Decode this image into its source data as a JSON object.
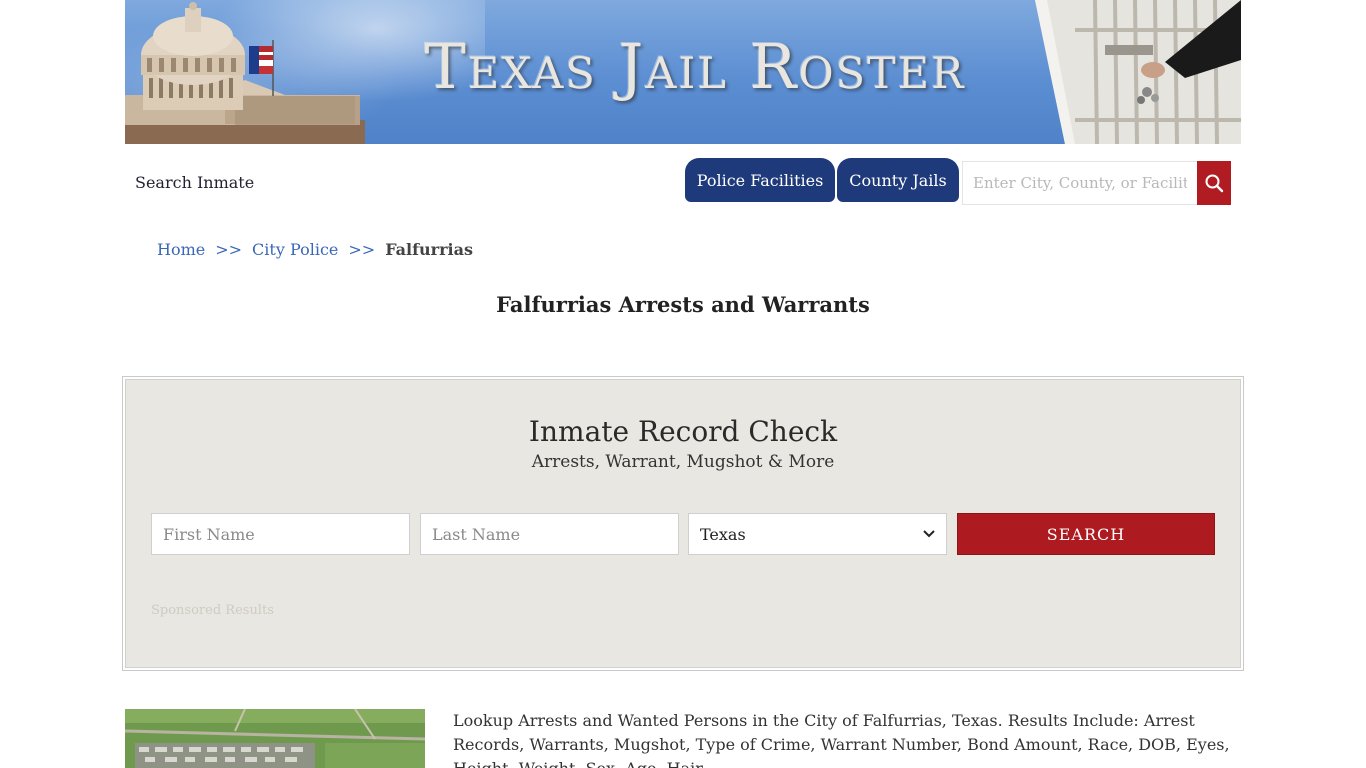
{
  "banner": {
    "title": "Texas Jail Roster"
  },
  "nav": {
    "search_inmate": "Search Inmate",
    "tabs": [
      {
        "label": "Police Facilities"
      },
      {
        "label": "County Jails"
      }
    ],
    "site_search_placeholder": "Enter City, County, or Facility"
  },
  "breadcrumb": {
    "items": [
      {
        "label": "Home"
      },
      {
        "label": "City Police"
      },
      {
        "label": "Falfurrias"
      }
    ],
    "separator": ">>"
  },
  "page_title": "Falfurrias Arrests and Warrants",
  "record_check": {
    "title": "Inmate Record Check",
    "subtitle": "Arrests, Warrant, Mugshot & More",
    "first_name_placeholder": "First Name",
    "last_name_placeholder": "Last Name",
    "state_selected": "Texas",
    "search_label": "SEARCH",
    "sponsored": "Sponsored Results"
  },
  "description": "Lookup Arrests and Wanted Persons in the City of Falfurrias, Texas. Results Include: Arrest Records, Warrants, Mugshot, Type of Crime, Warrant Number, Bond Amount, Race, DOB, Eyes, Height, Weight, Sex, Age, Hair.",
  "colors": {
    "nav_blue": "#1f3a7a",
    "accent_red": "#ad1a1f",
    "link_blue": "#3a67b8",
    "panel_bg": "#e9e7e1"
  }
}
